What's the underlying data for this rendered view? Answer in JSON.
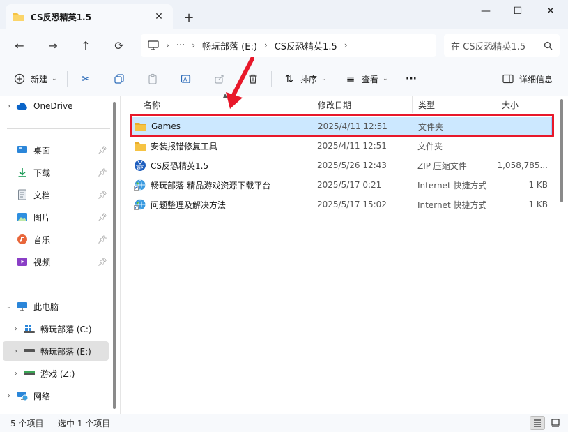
{
  "window": {
    "tab_title": "CS反恐精英1.5",
    "new_tab_label": "+",
    "minimize_glyph": "—",
    "maximize_glyph": "☐",
    "close_glyph": "✕"
  },
  "address": {
    "more_glyph": "···",
    "crumbs": [
      "畅玩部落 (E:)",
      "CS反恐精英1.5"
    ],
    "search_placeholder": "在 CS反恐精英1.5"
  },
  "toolbar": {
    "new_label": "新建",
    "sort_label": "排序",
    "view_label": "查看",
    "more_glyph": "···",
    "details_label": "详细信息"
  },
  "sidebar": {
    "onedrive": "OneDrive",
    "quick": [
      {
        "label": "桌面",
        "icon": "desktop-icon"
      },
      {
        "label": "下载",
        "icon": "download-icon"
      },
      {
        "label": "文档",
        "icon": "document-icon"
      },
      {
        "label": "图片",
        "icon": "picture-icon"
      },
      {
        "label": "音乐",
        "icon": "music-icon"
      },
      {
        "label": "视频",
        "icon": "video-icon"
      }
    ],
    "this_pc": "此电脑",
    "drives": [
      {
        "label": "畅玩部落 (C:)",
        "icon": "windows-drive-icon"
      },
      {
        "label": "畅玩部落 (E:)",
        "icon": "drive-icon",
        "selected": true
      },
      {
        "label": "游戏 (Z:)",
        "icon": "drive-green-icon"
      }
    ],
    "network": "网络"
  },
  "columns": {
    "name": "名称",
    "date": "修改日期",
    "type": "类型",
    "size": "大小"
  },
  "files": [
    {
      "name": "Games",
      "date": "2025/4/11 12:51",
      "type": "文件夹",
      "size": "",
      "icon": "folder-icon",
      "selected": true
    },
    {
      "name": "安装报错修复工具",
      "date": "2025/4/11 12:51",
      "type": "文件夹",
      "size": "",
      "icon": "folder-icon"
    },
    {
      "name": "CS反恐精英1.5",
      "date": "2025/5/26 12:43",
      "type": "ZIP 压缩文件",
      "size": "1,058,785...",
      "icon": "zip-icon"
    },
    {
      "name": "畅玩部落-精品游戏资源下载平台",
      "date": "2025/5/17 0:21",
      "type": "Internet 快捷方式",
      "size": "1 KB",
      "icon": "internet-shortcut-icon"
    },
    {
      "name": "问题整理及解决方法",
      "date": "2025/5/17 15:02",
      "type": "Internet 快捷方式",
      "size": "1 KB",
      "icon": "internet-shortcut-icon"
    }
  ],
  "status": {
    "item_count": "5 个项目",
    "selected_count": "选中 1 个项目"
  },
  "colors": {
    "accent": "#0067c0",
    "selection": "#cce8ff",
    "annotation": "#e8182a",
    "folder": "#f6c343"
  }
}
